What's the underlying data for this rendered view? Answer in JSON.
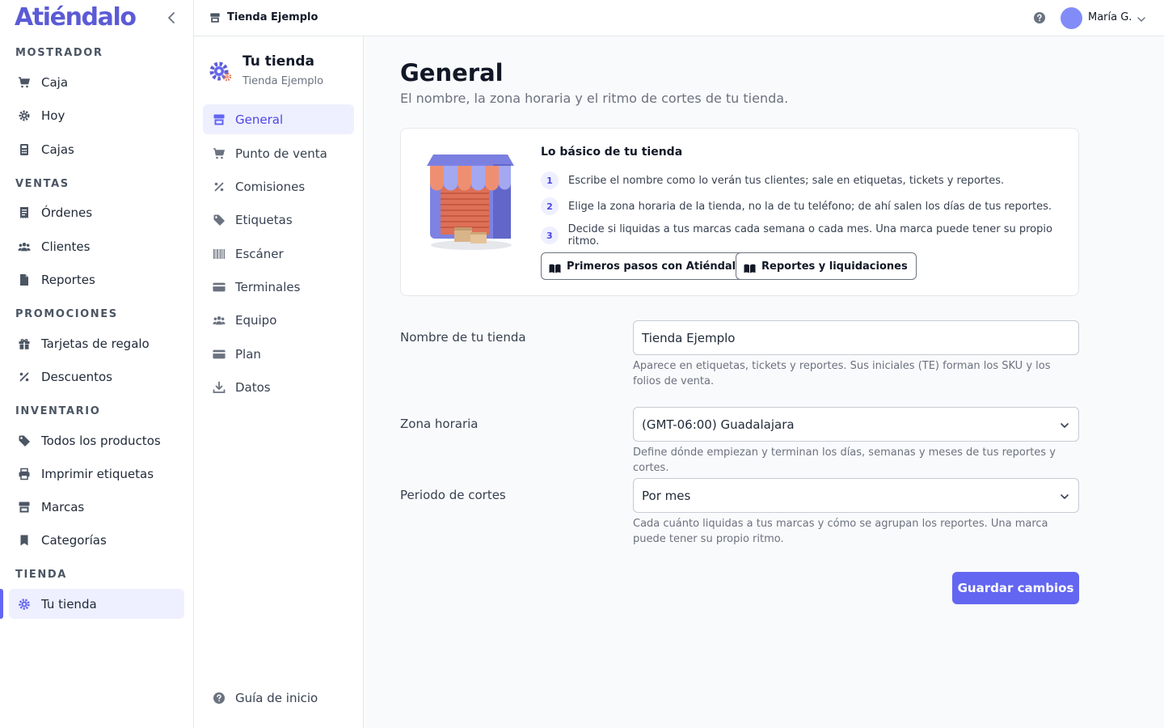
{
  "app": {
    "brand": "Atiéndalo"
  },
  "sidebar": {
    "sections": [
      {
        "title": "MOSTRADOR",
        "items": [
          {
            "label": "Caja",
            "icon": "cart-icon"
          },
          {
            "label": "Hoy",
            "icon": "gear-badge-icon"
          },
          {
            "label": "Cajas",
            "icon": "calculator-icon"
          }
        ]
      },
      {
        "title": "VENTAS",
        "items": [
          {
            "label": "Órdenes",
            "icon": "receipt-icon"
          },
          {
            "label": "Clientes",
            "icon": "users-icon"
          },
          {
            "label": "Reportes",
            "icon": "document-icon"
          }
        ]
      },
      {
        "title": "PROMOCIONES",
        "items": [
          {
            "label": "Tarjetas de regalo",
            "icon": "gift-icon"
          },
          {
            "label": "Descuentos",
            "icon": "percent-icon"
          }
        ]
      },
      {
        "title": "INVENTARIO",
        "items": [
          {
            "label": "Todos los productos",
            "icon": "tag-icon"
          },
          {
            "label": "Imprimir etiquetas",
            "icon": "printer-icon"
          },
          {
            "label": "Marcas",
            "icon": "store-icon"
          },
          {
            "label": "Categorías",
            "icon": "bookmark-icon"
          }
        ]
      },
      {
        "title": "TIENDA",
        "items": [
          {
            "label": "Tu tienda",
            "icon": "settings-icon",
            "active": true
          }
        ]
      }
    ]
  },
  "topbar": {
    "breadcrumb": "Tienda Ejemplo",
    "user": "María G."
  },
  "subnav": {
    "title": "Tu tienda",
    "subtitle": "Tienda Ejemplo",
    "items": [
      {
        "label": "General",
        "icon": "store-icon",
        "active": true
      },
      {
        "label": "Punto de venta",
        "icon": "cart-icon"
      },
      {
        "label": "Comisiones",
        "icon": "percent-icon"
      },
      {
        "label": "Etiquetas",
        "icon": "tag-icon"
      },
      {
        "label": "Escáner",
        "icon": "barcode-icon"
      },
      {
        "label": "Terminales",
        "icon": "card-icon"
      },
      {
        "label": "Equipo",
        "icon": "users-icon"
      },
      {
        "label": "Plan",
        "icon": "card-icon"
      },
      {
        "label": "Datos",
        "icon": "download-icon"
      }
    ],
    "footer": "Guía de inicio"
  },
  "main": {
    "title": "General",
    "subtitle": "El nombre, la zona horaria y el ritmo de cortes de tu tienda.",
    "card": {
      "title": "Lo básico de tu tienda",
      "steps": [
        {
          "num": "1",
          "text": "Escribe el nombre como lo verán tus clientes; sale en etiquetas, tickets y reportes."
        },
        {
          "num": "2",
          "text": "Elige la zona horaria de la tienda, no la de tu teléfono; de ahí salen los días de tus reportes."
        },
        {
          "num": "3",
          "text": "Decide si liquidas a tus marcas cada semana o cada mes. Una marca puede tener su propio ritmo."
        }
      ],
      "buttons": [
        "Primeros pasos con Atiéndalo",
        "Reportes y liquidaciones"
      ]
    },
    "fields": {
      "store_name": {
        "label": "Nombre de tu tienda",
        "value": "Tienda Ejemplo",
        "help": "Aparece en etiquetas, tickets y reportes. Sus iniciales (TE) forman los SKU y los folios de venta."
      },
      "timezone": {
        "label": "Zona horaria",
        "value": "(GMT-06:00) Guadalajara",
        "help": "Define dónde empiezan y terminan los días, semanas y meses de tus reportes y cortes."
      },
      "period": {
        "label": "Periodo de cortes",
        "value": "Por mes",
        "help": "Cada cuánto liquidas a tus marcas y cómo se agrupan los reportes. Una marca puede tener su propio ritmo."
      }
    },
    "save_label": "Guardar cambios"
  },
  "colors": {
    "accent": "#6366f1",
    "brand": "#5b5bd6",
    "active_bg": "#eef0ff"
  }
}
